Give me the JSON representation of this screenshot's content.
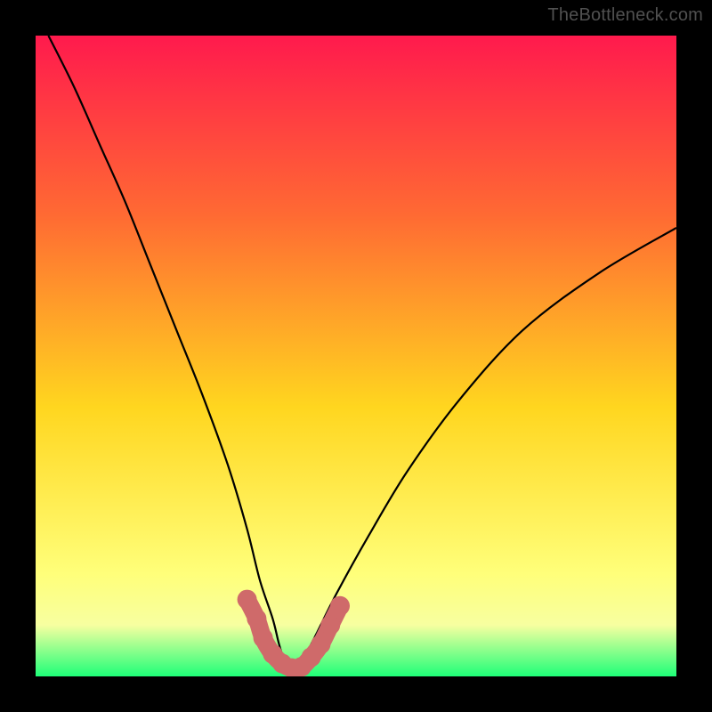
{
  "watermark": "TheBottleneck.com",
  "gradient": {
    "top": "#ff1a4d",
    "upper": "#ff6a33",
    "mid": "#ffd61f",
    "lower": "#ffff7a",
    "band": "#f7ffa0",
    "bottom": "#1eff78"
  },
  "curve_color": "#000000",
  "marker_color": "#cf6a6a",
  "chart_data": {
    "type": "line",
    "title": "",
    "xlabel": "",
    "ylabel": "",
    "xlim": [
      0,
      100
    ],
    "ylim": [
      0,
      100
    ],
    "series": [
      {
        "name": "bottleneck-curve",
        "x": [
          2,
          6,
          10,
          14,
          18,
          22,
          26,
          30,
          33,
          35,
          37,
          38,
          39,
          40,
          41,
          42,
          44,
          47,
          52,
          58,
          66,
          76,
          88,
          100
        ],
        "values": [
          100,
          92,
          83,
          74,
          64,
          54,
          44,
          33,
          23,
          15,
          9,
          5,
          2,
          1,
          1,
          3,
          7,
          13,
          22,
          32,
          43,
          54,
          63,
          70
        ]
      }
    ],
    "markers": {
      "name": "highlighted-points",
      "x": [
        33.0,
        34.5,
        35.5,
        37.0,
        38.5,
        40.0,
        41.5,
        43.0,
        44.5,
        46.0,
        47.5
      ],
      "values": [
        12.0,
        9.0,
        6.0,
        3.5,
        2.0,
        1.3,
        1.5,
        3.0,
        5.0,
        8.0,
        11.0
      ]
    }
  }
}
